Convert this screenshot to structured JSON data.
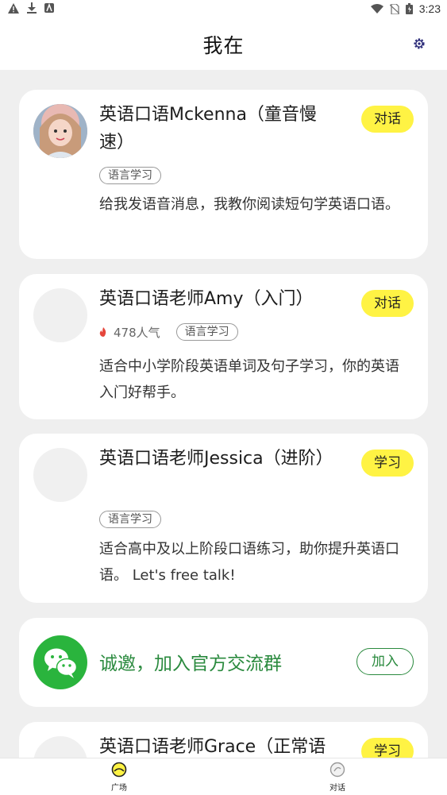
{
  "status_bar": {
    "time": "3:23"
  },
  "header": {
    "title": "我在"
  },
  "cards": [
    {
      "title": "英语口语Mckenna（童音慢速）",
      "action": "对话",
      "tag": "语言学习",
      "desc": "给我发语音消息，我教你阅读短句学英语口语。"
    },
    {
      "title": "英语口语老师Amy（入门）",
      "action": "对话",
      "popularity": "478人气",
      "tag": "语言学习",
      "desc": "适合中小学阶段英语单词及句子学习，你的英语入门好帮手。"
    },
    {
      "title": "英语口语老师Jessica（进阶）",
      "action": "学习",
      "tag": "语言学习",
      "desc": "适合高中及以上阶段口语练习，助你提升英语口语。 Let's free talk!"
    },
    {
      "title": "英语口语老师Grace（正常语",
      "action": "学习"
    }
  ],
  "join_card": {
    "title": "诚邀，加入官方交流群",
    "button": "加入"
  },
  "tabs": [
    {
      "label": "广场",
      "icon": "plaza-icon"
    },
    {
      "label": "对话",
      "icon": "chat-icon"
    }
  ],
  "colors": {
    "accent_yellow": "#fff344",
    "wechat_green": "#2ab43d",
    "join_green": "#2a8a3e"
  }
}
